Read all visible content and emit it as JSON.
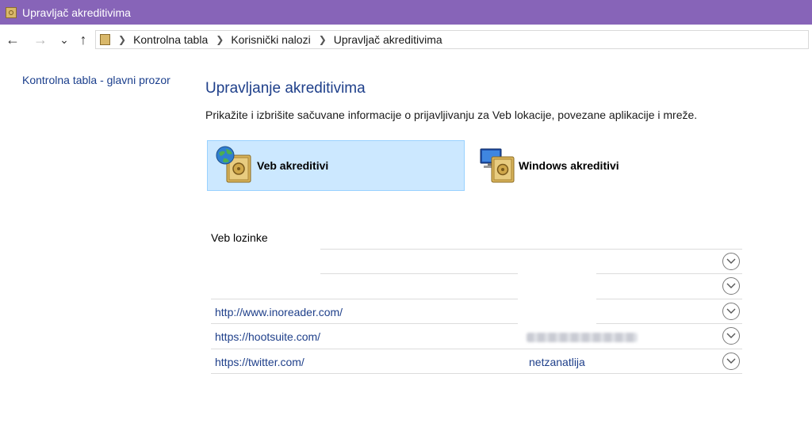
{
  "window": {
    "title": "Upravljač akreditivima"
  },
  "nav": {
    "back_icon": "←",
    "forward_icon": "→",
    "history_icon": "⌄",
    "up_icon": "↑"
  },
  "breadcrumb": [
    "Kontrolna tabla",
    "Korisnički nalozi",
    "Upravljač akreditivima"
  ],
  "sidebar": {
    "home_link": "Kontrolna tabla - glavni prozor"
  },
  "main": {
    "heading": "Upravljanje akreditivima",
    "description": "Prikažite i izbrišite sačuvane informacije o prijavljivanju za Veb lokacije, povezane aplikacije i mreže.",
    "tiles": [
      {
        "label": "Veb akreditivi",
        "icon": "globe-vault-icon",
        "selected": true
      },
      {
        "label": "Windows akreditivi",
        "icon": "computer-vault-icon",
        "selected": false
      }
    ],
    "section_title": "Veb lozinke",
    "entries": [
      {
        "url": "",
        "user": ""
      },
      {
        "url": "",
        "user": ""
      },
      {
        "url": "http://www.inoreader.com/",
        "user": ""
      },
      {
        "url": "https://hootsuite.com/",
        "user": ""
      },
      {
        "url": "https://twitter.com/",
        "user": "netzanatlija"
      }
    ]
  },
  "colors": {
    "titlebar": "#8764b8",
    "link": "#1e3f8a",
    "selected_tile": "#cce8ff"
  }
}
